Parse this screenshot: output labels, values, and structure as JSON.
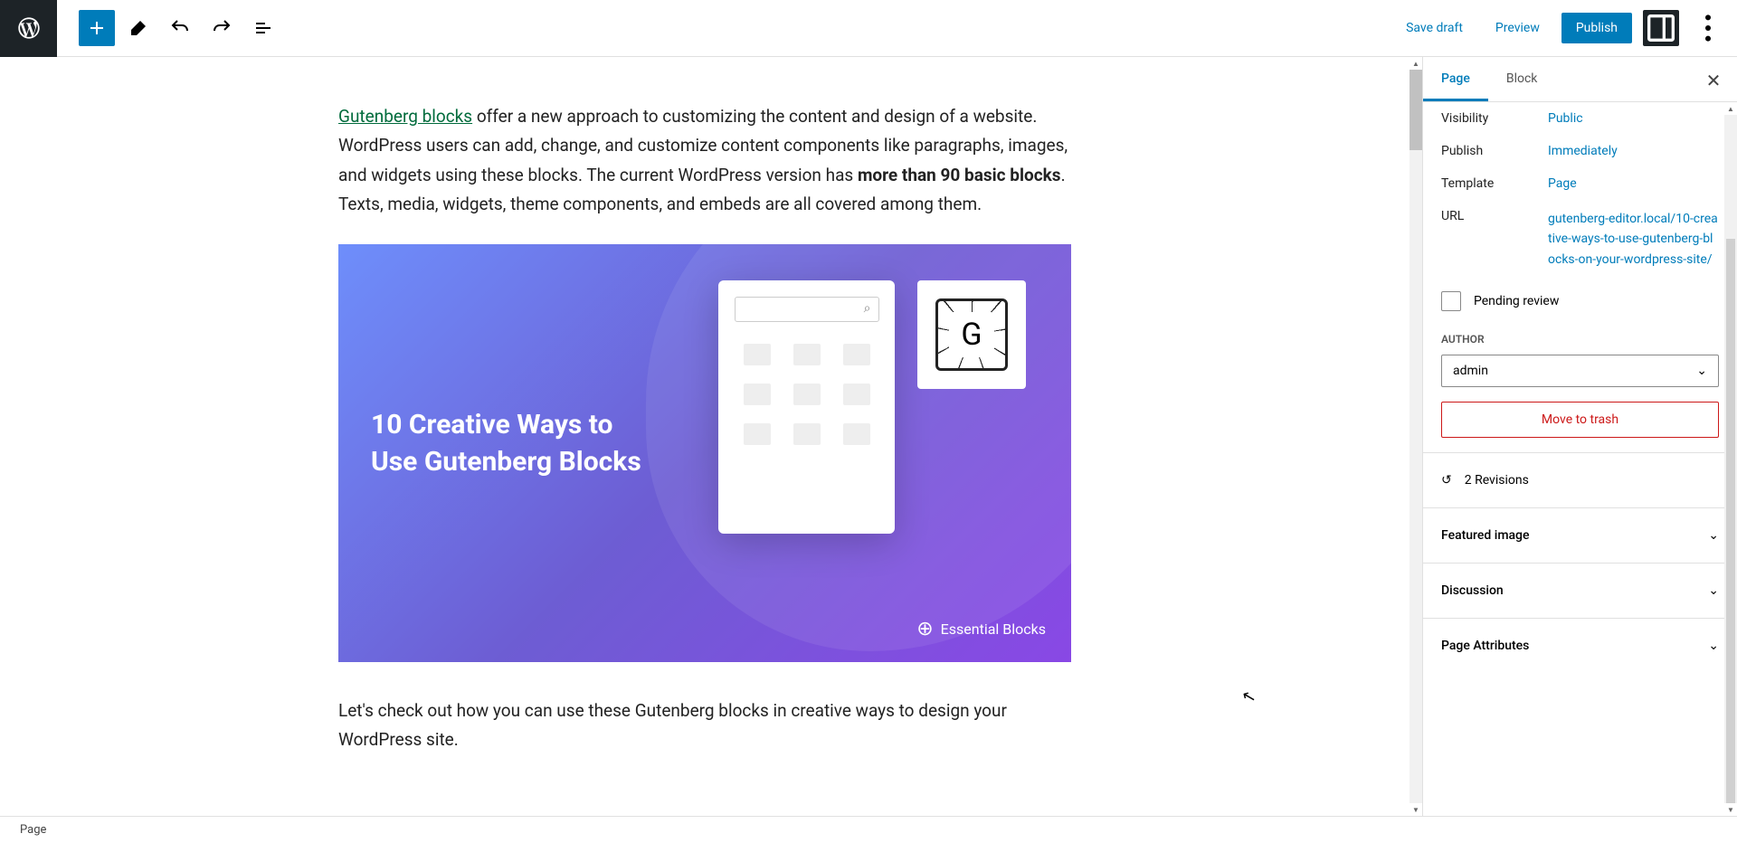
{
  "toolbar": {
    "save_draft": "Save draft",
    "preview": "Preview",
    "publish": "Publish"
  },
  "content": {
    "p1_linktext": "Gutenberg blocks",
    "p1_a": " offer a new approach to customizing the content and design of a website. WordPress users can add, change, and customize content components like paragraphs, images, and widgets using these blocks. The current WordPress version has ",
    "p1_bold": "more than 90 basic blocks",
    "p1_b": ". Texts, media, widgets, theme components, and embeds are all covered among them.",
    "hero_title_l1": "10 Creative Ways to",
    "hero_title_l2": "Use Gutenberg Blocks",
    "hero_brand": "Essential Blocks",
    "p2": "Let's check out how you can use these Gutenberg blocks in creative ways to design your WordPress site."
  },
  "sidebar": {
    "tabs": {
      "page": "Page",
      "block": "Block"
    },
    "visibility": {
      "label": "Visibility",
      "value": "Public"
    },
    "publish": {
      "label": "Publish",
      "value": "Immediately"
    },
    "template": {
      "label": "Template",
      "value": "Page"
    },
    "url": {
      "label": "URL",
      "value": "gutenberg-editor.local/10-creative-ways-to-use-gutenberg-blocks-on-your-wordpress-site/"
    },
    "pending_review": "Pending review",
    "author_label": "AUTHOR",
    "author_value": "admin",
    "move_to_trash": "Move to trash",
    "revisions": "2 Revisions",
    "featured_image": "Featured image",
    "discussion": "Discussion",
    "page_attributes": "Page Attributes"
  },
  "footer": {
    "breadcrumb": "Page"
  }
}
